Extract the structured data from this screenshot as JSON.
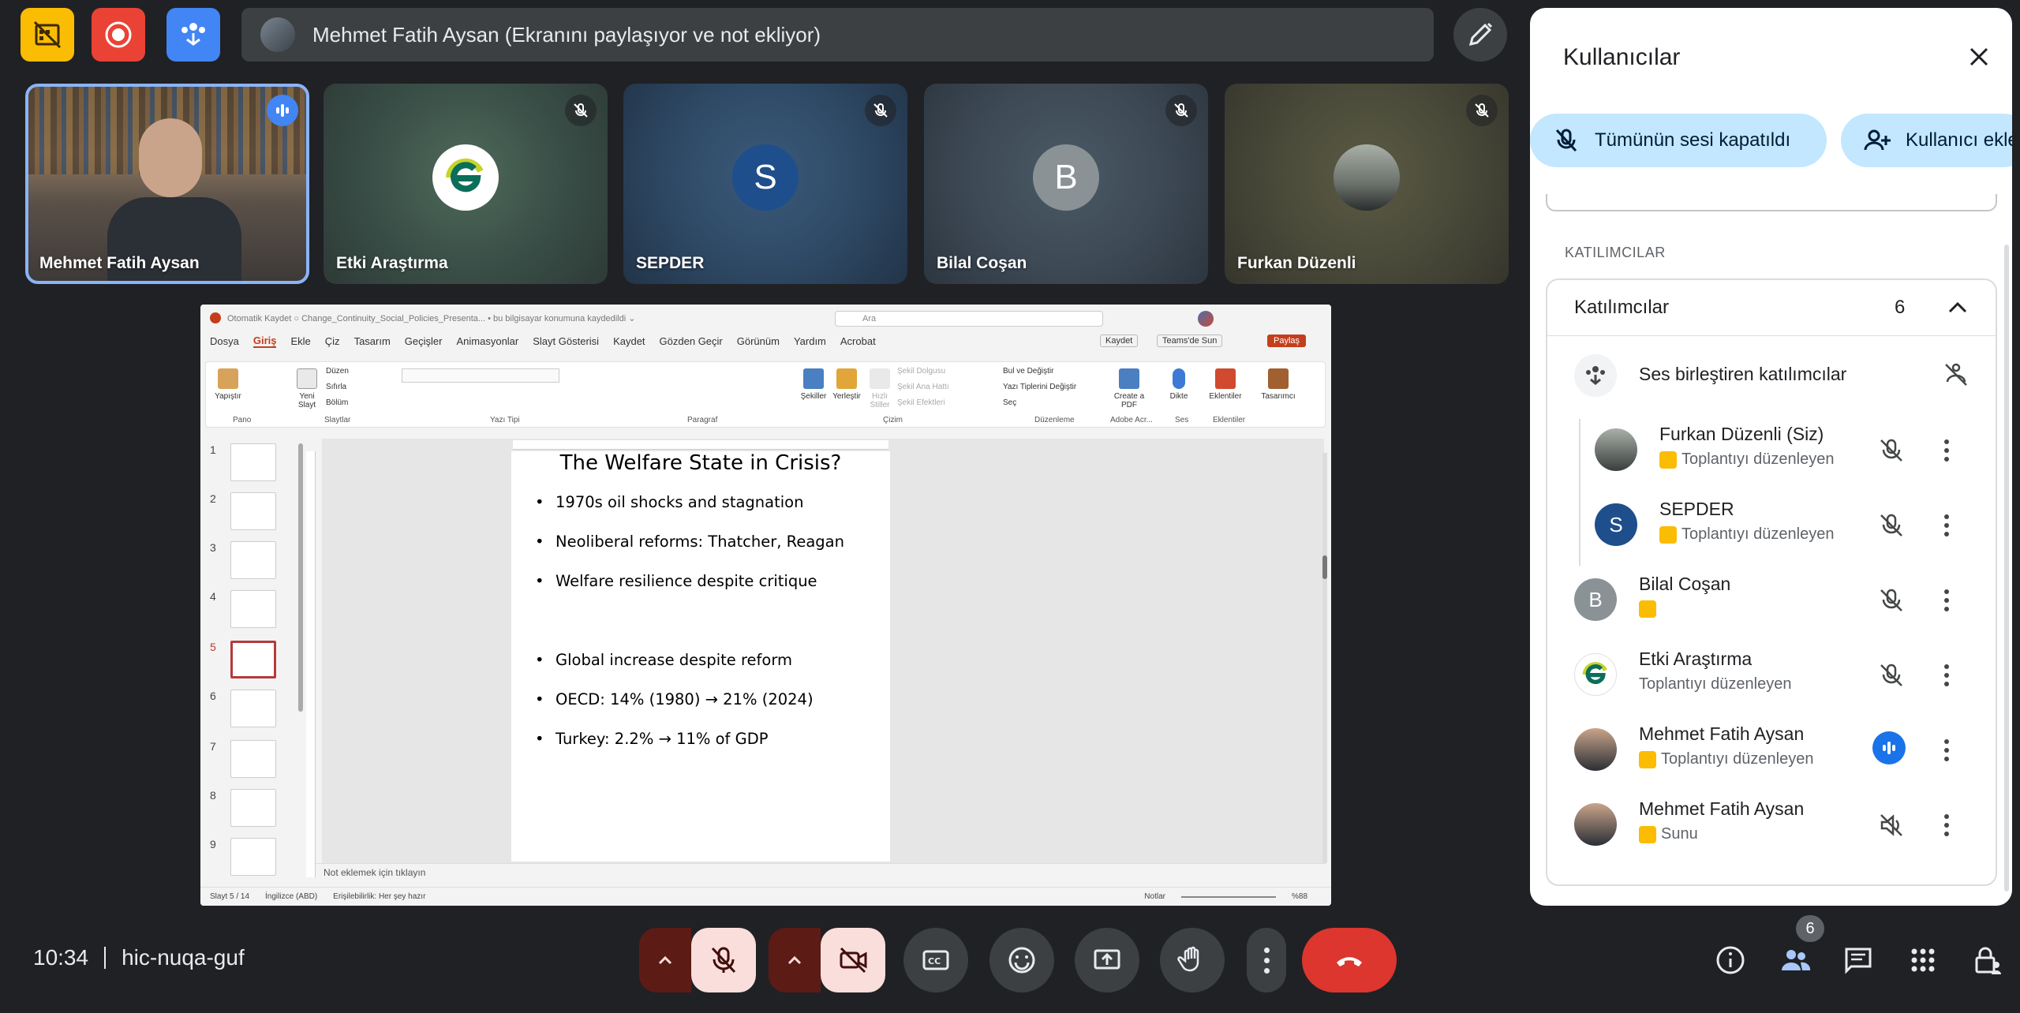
{
  "presenter_bar": {
    "text": "Mehmet Fatih Aysan (Ekranını paylaşıyor ve not ekliyor)"
  },
  "tiles": [
    {
      "name": "Mehmet Fatih Aysan"
    },
    {
      "name": "Etki Araştırma"
    },
    {
      "name": "SEPDER",
      "initial": "S"
    },
    {
      "name": "Bilal Coşan",
      "initial": "B"
    },
    {
      "name": "Furkan Düzenli"
    }
  ],
  "powerpoint": {
    "title_text": "Otomatik Kaydet  ○  Change_Continuity_Social_Policies_Presenta... • bu bilgisayar konumuna kaydedildi ⌄",
    "search": "Ara",
    "menu": [
      "Dosya",
      "Giriş",
      "Ekle",
      "Çiz",
      "Tasarım",
      "Geçişler",
      "Animasyonlar",
      "Slayt Gösterisi",
      "Kaydet",
      "Gözden Geçir",
      "Görünüm",
      "Yardım",
      "Acrobat"
    ],
    "right_buttons": [
      "Kaydet",
      "Teams'de Sun",
      "Paylaş"
    ],
    "ribbon": {
      "paste": "Yapıştır",
      "new_slide": "Yeni Slayt",
      "layout": "Düzen",
      "reset": "Sıfırla",
      "section": "Bölüm",
      "shapes": "Şekiller",
      "arrange": "Yerleştir",
      "quick_styles": "Hızlı Stiller",
      "shape_fill": "Şekil Dolgusu",
      "shape_outline": "Şekil Ana Hattı",
      "shape_effects": "Şekil Efektleri",
      "find_replace": "Bul ve Değiştir",
      "replace_fonts": "Yazı Tiplerini Değiştir",
      "select": "Seç",
      "create_pdf": "Create a PDF",
      "dictate": "Dikte",
      "addins": "Eklentiler",
      "designer": "Tasarımcı",
      "groups": [
        "Pano",
        "Slaytlar",
        "Yazı Tipi",
        "Paragraf",
        "Çizim",
        "Düzenleme",
        "Adobe Acr...",
        "Ses",
        "Eklentiler"
      ]
    },
    "thumb_numbers": [
      "1",
      "2",
      "3",
      "4",
      "5",
      "6",
      "7",
      "8",
      "9"
    ],
    "selected_slide": 5,
    "slide": {
      "title": "The Welfare State in Crisis?",
      "bullets_a": [
        "1970s oil shocks and stagnation",
        "Neoliberal reforms: Thatcher, Reagan",
        "Welfare resilience despite critique"
      ],
      "bullets_b": [
        "Global increase despite reform",
        "OECD: 14% (1980) → 21% (2024)",
        "Turkey: 2.2% → 11% of GDP"
      ]
    },
    "notes": "Not eklemek için tıklayın",
    "status": [
      "Slayt 5 / 14",
      "İngilizce (ABD)",
      "Erişilebilirlik: Her şey hazır",
      "Notlar",
      "%88"
    ]
  },
  "panel": {
    "title": "Kullanıcılar",
    "mute_all": "Tümünün sesi kapatıldı",
    "add_user": "Kullanıcı ekle",
    "section": "KATILIMCILAR",
    "card_title": "Katılımcılar",
    "count": "6",
    "participants": [
      {
        "name": "Ses birleştiren katılımcılar",
        "role": ""
      },
      {
        "name": "Furkan Düzenli (Siz)",
        "role": "Toplantıyı düzenleyen"
      },
      {
        "name": "SEPDER",
        "role": "Toplantıyı düzenleyen",
        "initial": "S"
      },
      {
        "name": "Bilal Coşan",
        "role": "",
        "initial": "B"
      },
      {
        "name": "Etki Araştırma",
        "role": "Toplantıyı düzenleyen"
      },
      {
        "name": "Mehmet Fatih Aysan",
        "role": "Toplantıyı düzenleyen"
      },
      {
        "name": "Mehmet Fatih Aysan",
        "role": "Sunu"
      }
    ]
  },
  "bottom": {
    "time": "10:34",
    "meeting_code": "hic-nuqa-guf",
    "people_badge": "6"
  },
  "colors": {
    "accent_yellow": "#fbbc04",
    "record_red": "#ea4335",
    "blue_btn": "#4285f4",
    "end_call": "#dc362e",
    "chip_blue": "#c2e7ff"
  }
}
